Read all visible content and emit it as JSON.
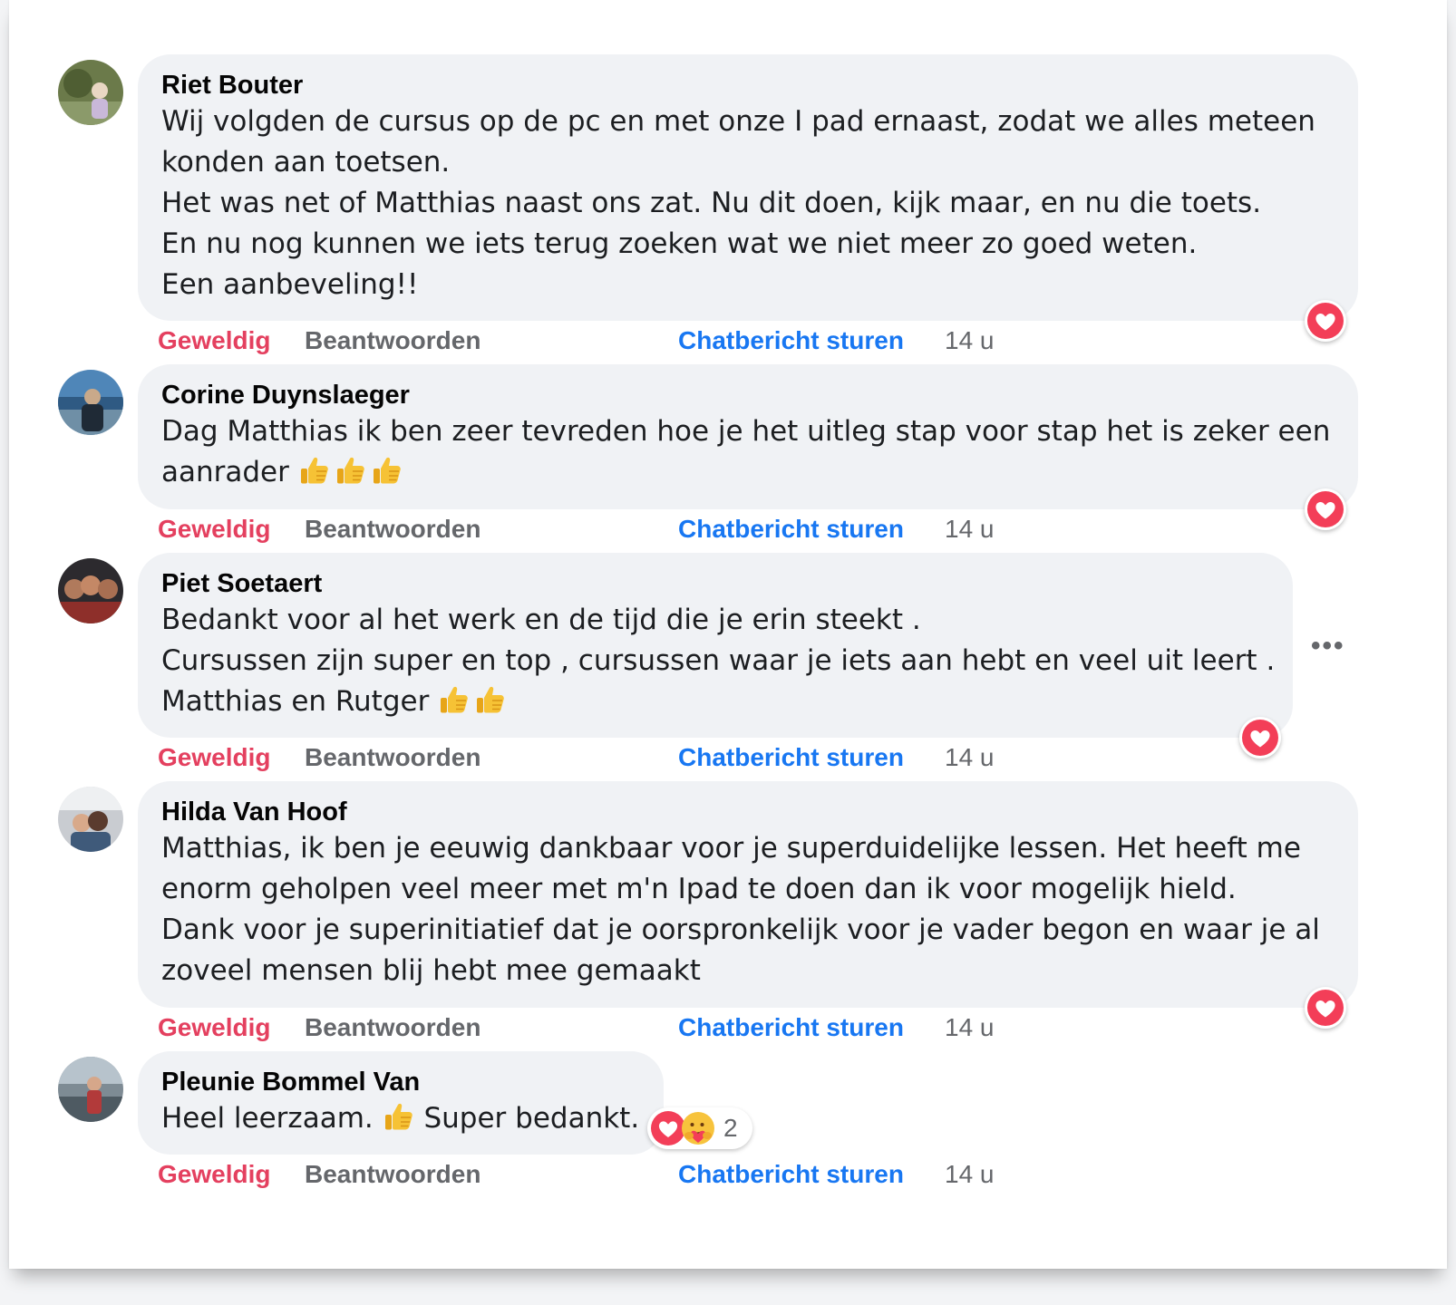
{
  "actions": {
    "like": "Geweldig",
    "reply": "Beantwoorden",
    "chat": "Chatbericht sturen"
  },
  "comments": [
    {
      "author": "Riet Bouter",
      "lines": [
        "Wij volgden de cursus op de pc en met onze I pad ernaast, zodat we alles meteen",
        "konden aan toetsen.",
        "Het was net of Matthias naast ons zat. Nu dit doen, kijk maar, en nu die toets.",
        "En nu nog kunnen we iets terug zoeken wat we niet meer zo goed weten.",
        "Een aanbeveling!!"
      ],
      "time": "14 u",
      "reaction": "heart-icon"
    },
    {
      "author": "Corine Duynslaeger",
      "lines": [
        "Dag Matthias ik ben zeer tevreden hoe je het uitleg stap voor stap het is zeker een",
        "aanrader"
      ],
      "emoji": [
        "thumbs-up-icon",
        "thumbs-up-icon",
        "thumbs-up-icon"
      ],
      "time": "14 u",
      "reaction": "heart-icon"
    },
    {
      "author": "Piet Soetaert",
      "lines": [
        "Bedankt voor al het werk en de tijd die je erin steekt .",
        "Cursussen zijn super en top , cursussen waar je iets aan hebt en veel uit leert .",
        "Matthias en Rutger"
      ],
      "emoji": [
        "thumbs-up-icon",
        "thumbs-up-icon"
      ],
      "time": "14 u",
      "reaction": "heart-icon",
      "more": "•••"
    },
    {
      "author": "Hilda Van Hoof",
      "lines": [
        "Matthias, ik ben je eeuwig dankbaar voor je superduidelijke lessen. Het heeft me",
        "enorm geholpen veel meer met m'n Ipad te doen dan ik voor mogelijk hield.",
        "Dank voor je superinitiatief dat je oorspronkelijk voor je vader begon en waar je al",
        "zoveel mensen blij hebt mee gemaakt"
      ],
      "time": "14 u",
      "reaction": "heart-icon"
    },
    {
      "author": "Pleunie Bommel Van",
      "text_before": "Heel leerzaam.",
      "text_after": "Super bedankt.",
      "time": "14 u",
      "reactions": [
        "heart-icon",
        "care-icon"
      ],
      "reaction_count": "2"
    }
  ]
}
